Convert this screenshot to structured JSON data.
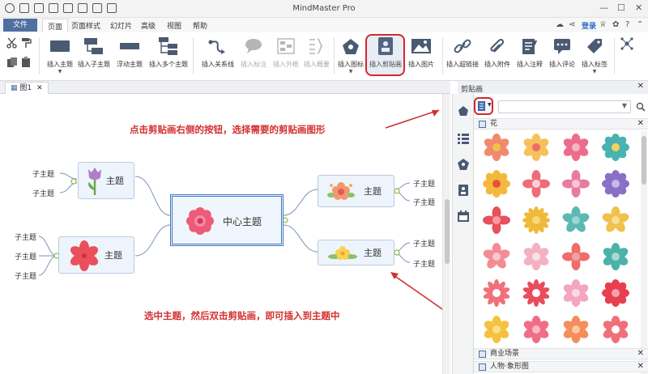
{
  "app": {
    "title": "MindMaster Pro",
    "login_label": "登录"
  },
  "menu": {
    "file": "文件",
    "tabs": [
      "页面样式",
      "幻灯片",
      "高级",
      "视图",
      "帮助"
    ],
    "active_tab": "页面"
  },
  "ribbon": {
    "insert_topic": "插入主题",
    "insert_subtopic": "插入子主题",
    "floating_topic": "浮动主题",
    "insert_multiple": "插入多个主题",
    "insert_relation": "插入关系线",
    "insert_callout": "插入标注",
    "insert_boundary": "插入外框",
    "insert_summary": "插入概要",
    "insert_icon": "插入图标",
    "insert_clipart": "插入剪贴画",
    "insert_image": "插入图片",
    "insert_hyperlink": "插入超链接",
    "insert_attachment": "插入附件",
    "insert_note": "插入注释",
    "insert_comment": "插入评论",
    "insert_tag": "插入标签"
  },
  "document": {
    "tab_label": "图1"
  },
  "mindmap": {
    "center": "中心主题",
    "topics": [
      "主题",
      "主题",
      "主题",
      "主题"
    ],
    "subtopic": "子主题"
  },
  "annotations": {
    "top": "点击剪贴画右侧的按钮，选择需要的剪贴画图形",
    "bottom": "选中主题，然后双击剪贴画，即可插入到主题中"
  },
  "panel": {
    "title": "剪贴画",
    "section_flower": "花",
    "section_business": "商业场景",
    "section_people": "人物·象形图"
  },
  "colors": {
    "accent_red": "#d8262e",
    "file_tab": "#4f6fa0",
    "center_border": "#3f78c4"
  }
}
